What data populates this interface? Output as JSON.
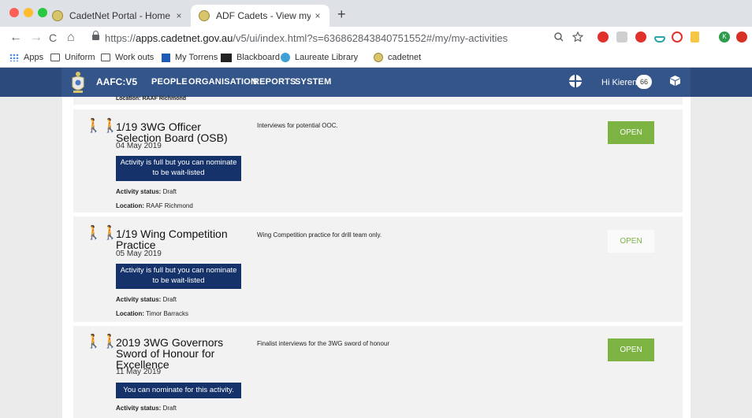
{
  "browser": {
    "tabs": [
      {
        "title": "CadetNet Portal - Home",
        "close": "×"
      },
      {
        "title": "ADF Cadets - View my activities",
        "close": "×"
      }
    ],
    "new_tab": "+",
    "nav": {
      "back": "←",
      "forward": "→",
      "reload": "C",
      "home": "⌂"
    },
    "url_prefix": "https://",
    "url_host": "apps.cadetnet.gov.au",
    "url_path": "/v5/ui/index.html?s=636862843840751552#/my/my-activities",
    "bookmarks": [
      "Apps",
      "Uniform",
      "Work outs",
      "My Torrens",
      "Blackboard",
      "Laureate Library",
      "cadetnet"
    ],
    "profile_initial": "K"
  },
  "app": {
    "brand": "AAFC:V5",
    "nav": [
      "PEOPLE",
      "ORGANISATION",
      "REPORTS",
      "SYSTEM"
    ],
    "greeting": "Hi Kieren",
    "badge": "66"
  },
  "partial_location": "Location: RAAF Richmond",
  "activities": [
    {
      "title": "1/19 3WG Officer Selection Board (OSB)",
      "date": "04 May 2019",
      "notice": "Activity is full but you can nominate to be wait-listed",
      "status_label": "Activity status:",
      "status": "Draft",
      "location_label": "Location:",
      "location": "RAAF Richmond",
      "description": "Interviews for potential OOC.",
      "button": "OPEN"
    },
    {
      "title": "1/19 Wing Competition Practice",
      "date": "05 May 2019",
      "notice": "Activity is full but you can nominate to be wait-listed",
      "status_label": "Activity status:",
      "status": "Draft",
      "location_label": "Location:",
      "location": "Timor Barracks",
      "description": "Wing Competition practice for drill team only.",
      "button": "OPEN"
    },
    {
      "title": "2019 3WG Governors Sword of Honour for Excellence",
      "date": "11 May 2019",
      "notice": "You can nominate for this activity.",
      "status_label": "Activity status:",
      "status": "Draft",
      "description": "Finalist interviews for the 3WG sword of honour",
      "button": "OPEN"
    }
  ],
  "colors": {
    "header": "#34558a",
    "notice": "#15326a",
    "open_button": "#7cb342",
    "card": "#f2f2f2"
  }
}
